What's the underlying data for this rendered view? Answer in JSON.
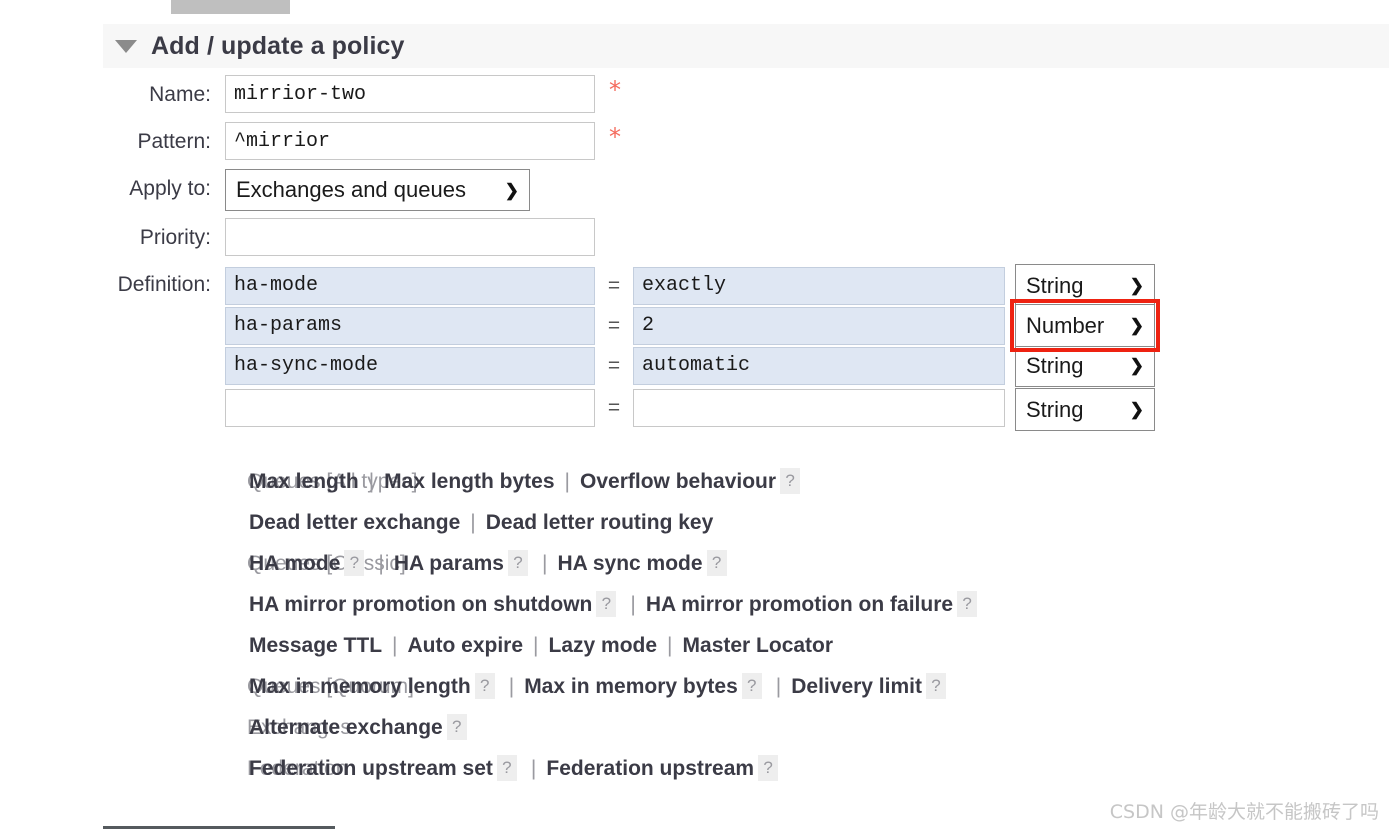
{
  "section": {
    "title": "Add / update a policy",
    "collapse_icon": "triangle-down-icon"
  },
  "form": {
    "name": {
      "label": "Name:",
      "value": "mirrior-two",
      "required_marker": "*"
    },
    "pattern": {
      "label": "Pattern:",
      "value": "^mirrior",
      "required_marker": "*"
    },
    "apply_to": {
      "label": "Apply to:",
      "value": "Exchanges and queues",
      "caret": "⌄"
    },
    "priority": {
      "label": "Priority:",
      "value": "",
      "placeholder": ""
    },
    "definition": {
      "label": "Definition:",
      "equals_sign": "=",
      "rows": [
        {
          "key": "ha-mode",
          "value": "exactly",
          "type": "String",
          "filled": true,
          "highlighted": false
        },
        {
          "key": "ha-params",
          "value": "2",
          "type": "Number",
          "filled": true,
          "highlighted": true
        },
        {
          "key": "ha-sync-mode",
          "value": "automatic",
          "type": "String",
          "filled": true,
          "highlighted": false
        },
        {
          "key": "",
          "value": "",
          "type": "String",
          "filled": false,
          "highlighted": false
        }
      ]
    }
  },
  "shortcuts": [
    {
      "category": "Queues [All types]",
      "lines": [
        [
          {
            "label": "Max length",
            "help": false
          },
          {
            "label": "Max length bytes",
            "help": false
          },
          {
            "label": "Overflow behaviour",
            "help": true
          }
        ],
        [
          {
            "label": "Dead letter exchange",
            "help": false
          },
          {
            "label": "Dead letter routing key",
            "help": false
          }
        ]
      ]
    },
    {
      "category": "Queues [Classic]",
      "lines": [
        [
          {
            "label": "HA mode",
            "help": true
          },
          {
            "label": "HA params",
            "help": true
          },
          {
            "label": "HA sync mode",
            "help": true
          }
        ],
        [
          {
            "label": "HA mirror promotion on shutdown",
            "help": true
          },
          {
            "label": "HA mirror promotion on failure",
            "help": true
          }
        ],
        [
          {
            "label": "Message TTL",
            "help": false
          },
          {
            "label": "Auto expire",
            "help": false
          },
          {
            "label": "Lazy mode",
            "help": false
          },
          {
            "label": "Master Locator",
            "help": false
          }
        ]
      ]
    },
    {
      "category": "Queues [Quorum]",
      "lines": [
        [
          {
            "label": "Max in memory length",
            "help": true
          },
          {
            "label": "Max in memory bytes",
            "help": true
          },
          {
            "label": "Delivery limit",
            "help": true
          }
        ]
      ]
    },
    {
      "category": "Exchanges",
      "lines": [
        [
          {
            "label": "Alternate exchange",
            "help": true
          }
        ]
      ]
    },
    {
      "category": "Federation",
      "lines": [
        [
          {
            "label": "Federation upstream set",
            "help": true
          },
          {
            "label": "Federation upstream",
            "help": true
          }
        ]
      ]
    }
  ],
  "help_badge": "?",
  "separator": "|",
  "watermark": "CSDN @年龄大就不能搬砖了吗",
  "colors": {
    "accent_red": "#ee2211",
    "required_star": "#f46b5d",
    "filled_input_bg": "#dfe7f3",
    "header_bg": "#f7f7f7",
    "muted_text": "#9a9aa0"
  }
}
